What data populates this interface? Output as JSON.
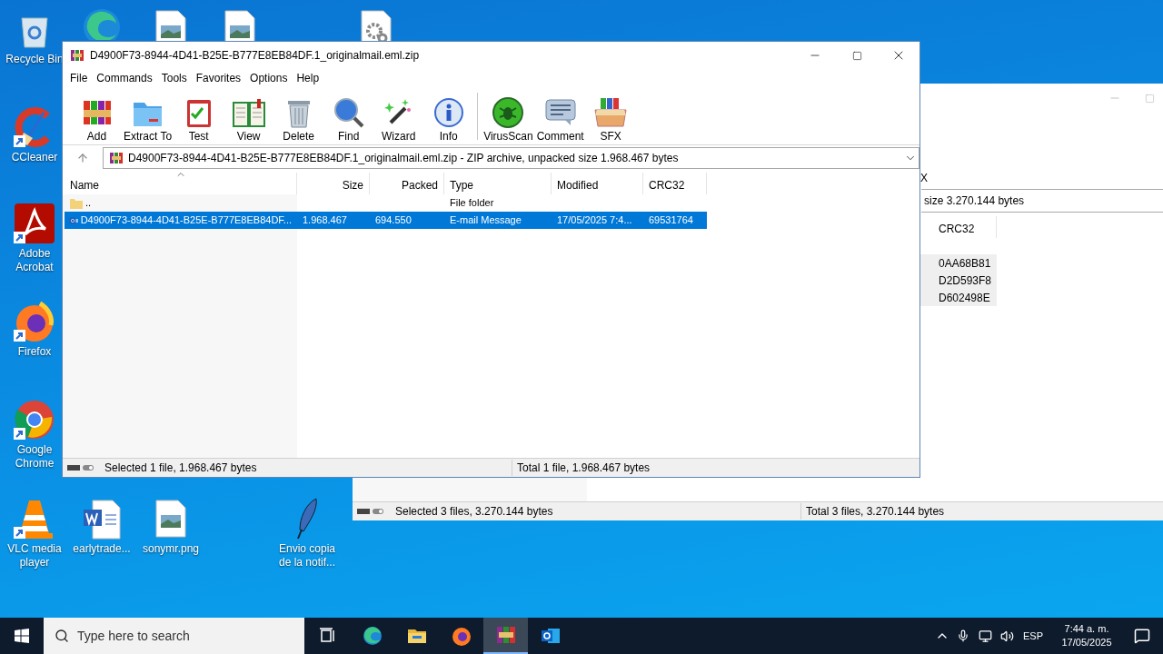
{
  "desktop": {
    "icons": [
      {
        "kind": "recycle",
        "shortcut": false,
        "label": "Recycle Bin"
      },
      {
        "kind": "edge",
        "shortcut": false
      },
      {
        "kind": "image",
        "shortcut": false
      },
      {
        "kind": "image",
        "shortcut": false
      },
      {
        "kind": "gear",
        "shortcut": false
      },
      {
        "kind": "ccleaner",
        "shortcut": true,
        "label": "CCleaner"
      },
      {
        "kind": "acrobat",
        "shortcut": true,
        "label": "Adobe Acrobat"
      },
      {
        "kind": "firefox",
        "shortcut": true,
        "label": "Firefox"
      },
      {
        "kind": "chrome",
        "shortcut": true,
        "label": "Google Chrome"
      },
      {
        "kind": "vlc",
        "shortcut": true,
        "label": "VLC media player"
      },
      {
        "kind": "word",
        "shortcut": false,
        "label": "earlytrade..."
      },
      {
        "kind": "image",
        "shortcut": false,
        "label": "sonymr.png"
      },
      {
        "kind": "quill",
        "shortcut": false,
        "label": "Envio copia de la notif..."
      }
    ]
  },
  "back_window": {
    "toolbar_tail": "X",
    "address_tail": "size 3.270.144 bytes",
    "columns": [
      "CRC32"
    ],
    "rows": [
      {
        "crc32": "0AA68B81"
      },
      {
        "crc32": "D2D593F8"
      },
      {
        "crc32": "D602498E"
      }
    ],
    "status_bar": {
      "left": "Selected 3 files, 3.270.144 bytes",
      "right": "Total 3 files, 3.270.144 bytes"
    }
  },
  "window": {
    "title": "D4900F73-8944-4D41-B25E-B777E8EB84DF.1_originalmail.eml.zip",
    "menu": [
      "File",
      "Commands",
      "Tools",
      "Favorites",
      "Options",
      "Help"
    ],
    "toolbar_groups": [
      [
        {
          "kind": "add",
          "label": "Add"
        },
        {
          "kind": "extract",
          "label": "Extract To"
        },
        {
          "kind": "test",
          "label": "Test"
        },
        {
          "kind": "view",
          "label": "View"
        },
        {
          "kind": "delete",
          "label": "Delete"
        },
        {
          "kind": "find",
          "label": "Find"
        },
        {
          "kind": "wizard",
          "label": "Wizard"
        },
        {
          "kind": "info",
          "label": "Info"
        }
      ],
      [
        {
          "kind": "virus",
          "label": "VirusScan"
        },
        {
          "kind": "comment",
          "label": "Comment"
        },
        {
          "kind": "sfx",
          "label": "SFX"
        }
      ]
    ],
    "address": "D4900F73-8944-4D41-B25E-B777E8EB84DF.1_originalmail.eml.zip - ZIP archive, unpacked size 1.968.467 bytes",
    "columns": [
      {
        "label": "Name",
        "sorted": true
      },
      {
        "label": "Size",
        "sorted": false
      },
      {
        "label": "Packed",
        "sorted": false
      },
      {
        "label": "Type",
        "sorted": false
      },
      {
        "label": "Modified",
        "sorted": false
      },
      {
        "label": "CRC32",
        "sorted": false
      }
    ],
    "rows": [
      {
        "kind": "folder",
        "name": "..",
        "type": "File folder",
        "selected": false
      },
      {
        "kind": "email",
        "name": "D4900F73-8944-4D41-B25E-B777E8EB84DF...",
        "size": "1.968.467",
        "packed": "694.550",
        "type": "E-mail Message",
        "modified": "17/05/2025 7:4...",
        "crc32": "69531764",
        "selected": true
      }
    ],
    "status_bar": {
      "left": "Selected 1 file, 1.968.467 bytes",
      "right": "Total 1 file, 1.968.467 bytes"
    }
  },
  "taskbar": {
    "search": {
      "placeholder": "Type here to search"
    },
    "apps": [
      {
        "kind": "taskview",
        "active": false
      },
      {
        "kind": "edge",
        "active": false
      },
      {
        "kind": "explorer",
        "active": false
      },
      {
        "kind": "firefox",
        "active": false
      },
      {
        "kind": "winrar",
        "active": true
      },
      {
        "kind": "outlook",
        "active": false
      }
    ],
    "tray": {
      "language": "ESP",
      "time": "7:44 a. m.",
      "date": "17/05/2025"
    }
  }
}
